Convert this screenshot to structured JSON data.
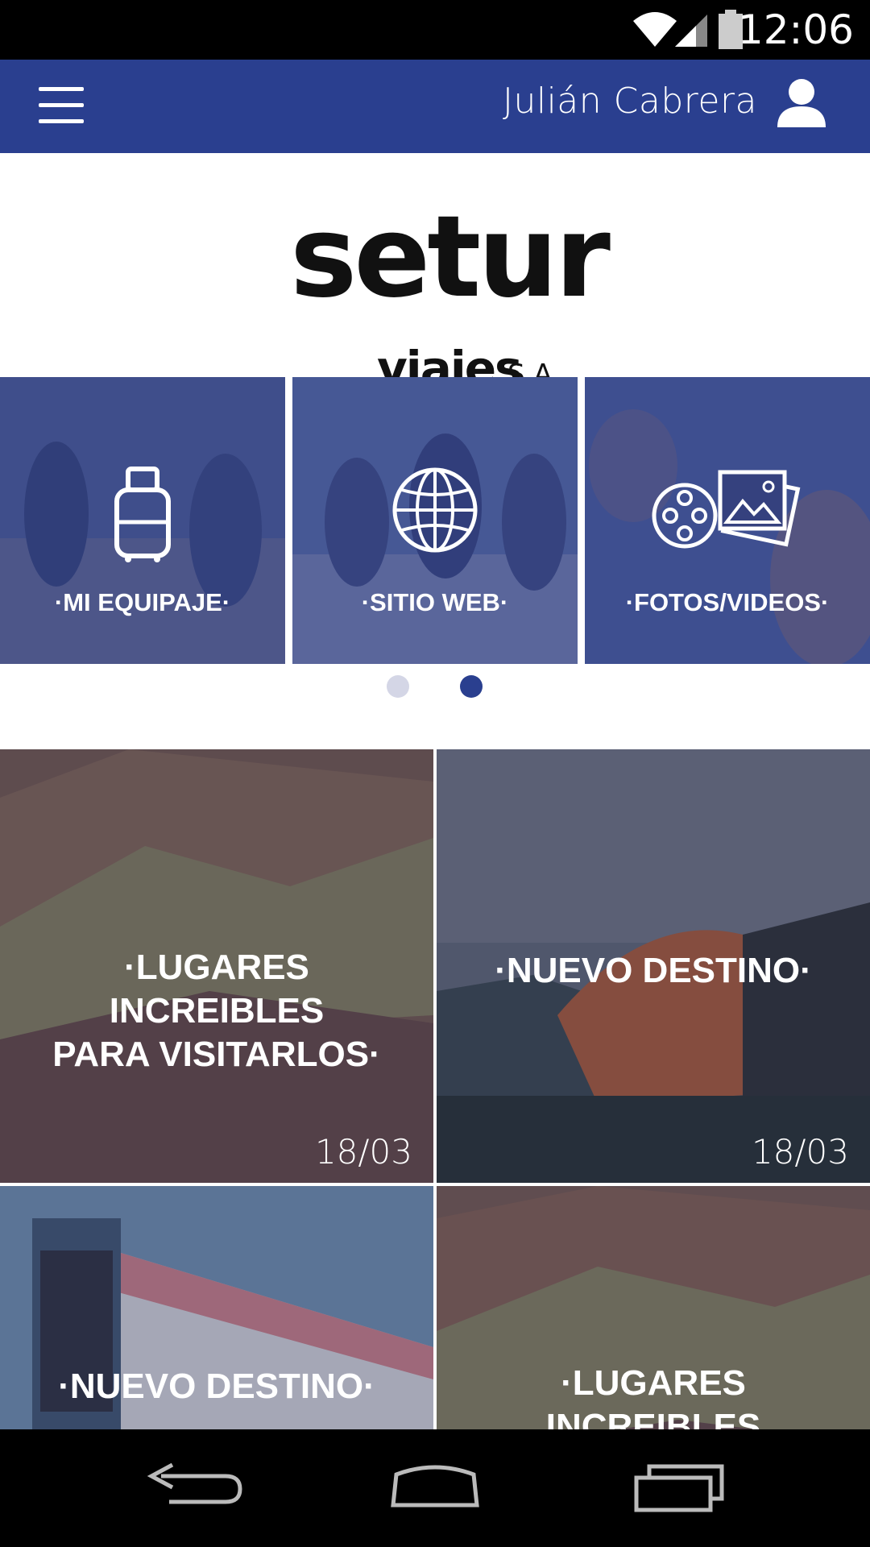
{
  "status_bar": {
    "time": "12:06"
  },
  "header": {
    "user_name": "Julián Cabrera"
  },
  "logo": {
    "brand": "setur",
    "sub": "viajes",
    "suffix": "S.A."
  },
  "quick_links": [
    {
      "label": "·MI EQUIPAJE·",
      "icon": "luggage-icon"
    },
    {
      "label": "·SITIO WEB·",
      "icon": "globe-icon"
    },
    {
      "label": "·FOTOS/VIDEOS·",
      "icon": "film-photos-icon"
    }
  ],
  "pager": {
    "count": 2,
    "active": 2
  },
  "cards": [
    {
      "title_line1": "·LUGARES INCREIBLES",
      "title_line2": "PARA VISITARLOS·",
      "date": "18/03"
    },
    {
      "title_line1": "·NUEVO DESTINO·",
      "title_line2": "",
      "date": "18/03"
    },
    {
      "title_line1": "·NUEVO DESTINO·",
      "title_line2": "",
      "date": ""
    },
    {
      "title_line1": "·LUGARES INCREIBLES",
      "title_line2": "",
      "date": ""
    }
  ],
  "colors": {
    "primary": "#2a3f8f",
    "dot_inactive": "#d4d6e6",
    "dot_active": "#2a3f8f"
  }
}
